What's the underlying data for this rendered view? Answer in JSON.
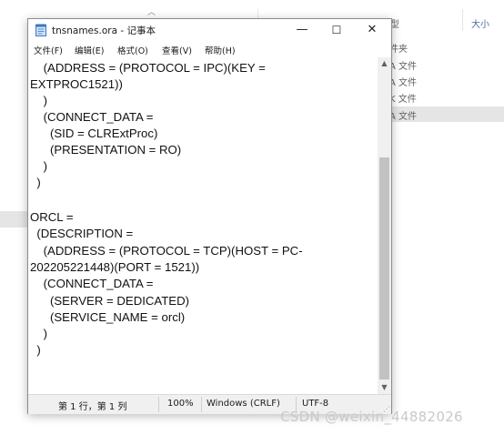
{
  "background": {
    "size_column_label": "大小",
    "rows": [
      "件夹",
      "A 文件",
      "A 文件",
      "K 文件",
      "A 文件"
    ],
    "watermark": "CSDN @weixin_44882026"
  },
  "window": {
    "title": "tnsnames.ora - 记事本",
    "controls": {
      "minimize": "—",
      "maximize": "☐",
      "close": "✕"
    },
    "menu": [
      "文件(F)",
      "编辑(E)",
      "格式(O)",
      "查看(V)",
      "帮助(H)"
    ],
    "content_lines": [
      "    (ADDRESS = (PROTOCOL = IPC)(KEY =",
      "EXTPROC1521))",
      "    )",
      "    (CONNECT_DATA =",
      "      (SID = CLRExtProc)",
      "      (PRESENTATION = RO)",
      "    )",
      "  )",
      "",
      "ORCL =",
      "  (DESCRIPTION =",
      "    (ADDRESS = (PROTOCOL = TCP)(HOST = PC-",
      "202205221448)(PORT = 1521))",
      "    (CONNECT_DATA =",
      "      (SERVER = DEDICATED)",
      "      (SERVICE_NAME = orcl)",
      "    )",
      "  )"
    ],
    "status": {
      "position": "第 1 行，第 1 列",
      "zoom": "100%",
      "line_ending": "Windows (CRLF)",
      "encoding": "UTF-8"
    }
  }
}
